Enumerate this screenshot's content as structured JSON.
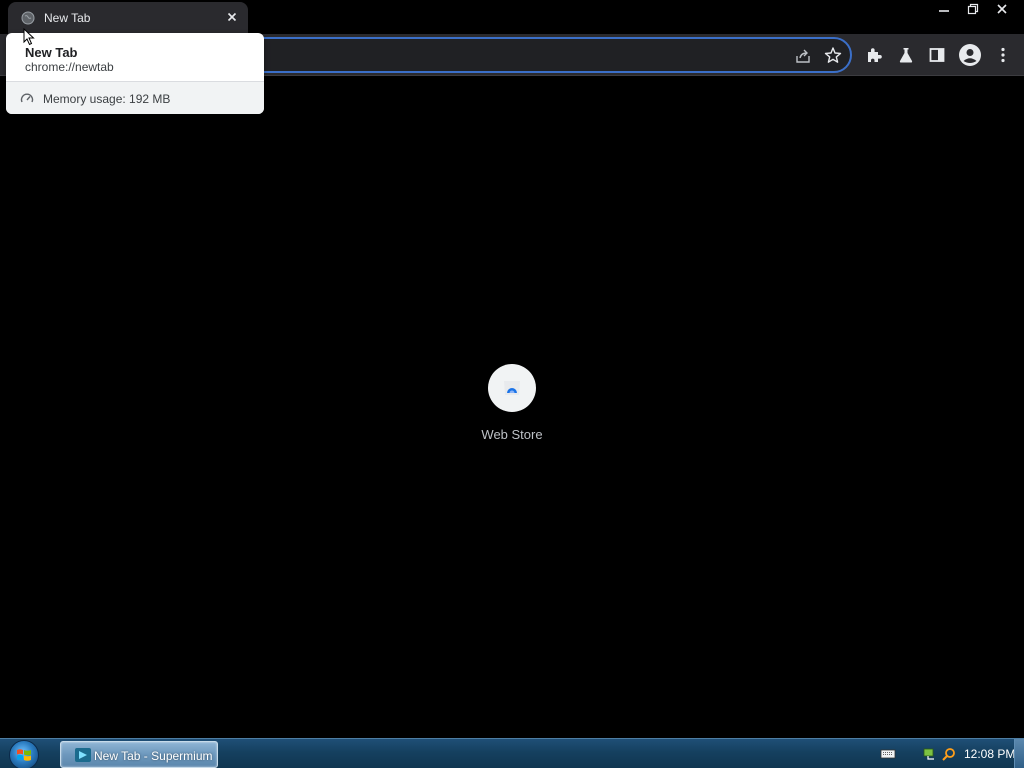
{
  "browser": {
    "tab": {
      "title": "New Tab",
      "favicon": "globe-icon",
      "close_icon": "close-icon"
    },
    "window_controls": [
      "minimize-icon",
      "restore-icon",
      "close-icon"
    ],
    "toolbar": {
      "omnibox_icons": [
        "share-icon",
        "bookmark-star-icon"
      ],
      "icons": [
        "extensions-puzzle-icon",
        "labs-flask-icon",
        "side-panel-icon",
        "profile-avatar-icon",
        "kebab-menu-icon"
      ]
    },
    "colors": {
      "omnibox_focus_ring": "#3b6fc8",
      "toolbar_bg": "#2a2a2e",
      "page_bg": "#000000"
    }
  },
  "hovercard": {
    "title": "New Tab",
    "url": "chrome://newtab",
    "memory": "Memory usage: 192 MB",
    "memory_icon": "gauge-icon"
  },
  "newtab": {
    "shortcuts": [
      {
        "label": "Web Store",
        "icon": "web-store-icon"
      }
    ]
  },
  "taskbar": {
    "start_icon": "windows-start-orb-icon",
    "task_button_label": "New Tab - Supermium",
    "tray_icons": [
      "keyboard-icon",
      "network-icon",
      "search-icon"
    ],
    "clock": "12:08 PM"
  }
}
